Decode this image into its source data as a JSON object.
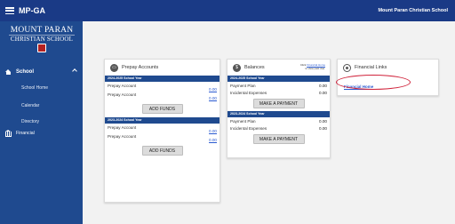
{
  "topbar": {
    "app_title": "MP-GA",
    "school_name": "Mount Paran Christian School"
  },
  "logo": {
    "line1": "MOUNT PARAN",
    "line2": "CHRISTIAN SCHOOL"
  },
  "sidebar": {
    "school_label": "School",
    "items": [
      {
        "label": "School Home"
      },
      {
        "label": "Calendar"
      },
      {
        "label": "Directory"
      }
    ],
    "financial_label": "Financial"
  },
  "prepay": {
    "title": "Prepay Accounts",
    "sections": [
      {
        "year": "2024-2025 School Year",
        "accounts": [
          {
            "name": "Prepay Account",
            "amount": "0.00"
          },
          {
            "name": "Prepay Account",
            "amount": "0.00"
          }
        ],
        "button": "ADD FUNDS"
      },
      {
        "year": "2023-2024 School Year",
        "accounts": [
          {
            "name": "Prepay Account",
            "amount": "0.00"
          },
          {
            "name": "Prepay Account",
            "amount": "0.00"
          }
        ],
        "button": "ADD FUNDS"
      }
    ]
  },
  "balances": {
    "title": "Balances",
    "note_prefix": "Click ",
    "note_link": "Financial Home",
    "note_suffix": "to view past due.",
    "sections": [
      {
        "year": "2024-2025 School Year",
        "rows": [
          {
            "label": "Payment Plan",
            "amount": "0.00"
          },
          {
            "label": "Incidental Expenses",
            "amount": "0.00"
          }
        ],
        "button": "MAKE A PAYMENT"
      },
      {
        "year": "2023-2024 School Year",
        "rows": [
          {
            "label": "Payment Plan",
            "amount": "0.00"
          },
          {
            "label": "Incidental Expenses",
            "amount": "0.00"
          }
        ],
        "button": "MAKE A PAYMENT"
      }
    ]
  },
  "financial_links": {
    "title": "Financial Links",
    "link": "Financial Home"
  },
  "colors": {
    "primary": "#1f4a8f",
    "topbar": "#1a3a86",
    "link": "#2a5ad0",
    "highlight": "#d0223a"
  }
}
